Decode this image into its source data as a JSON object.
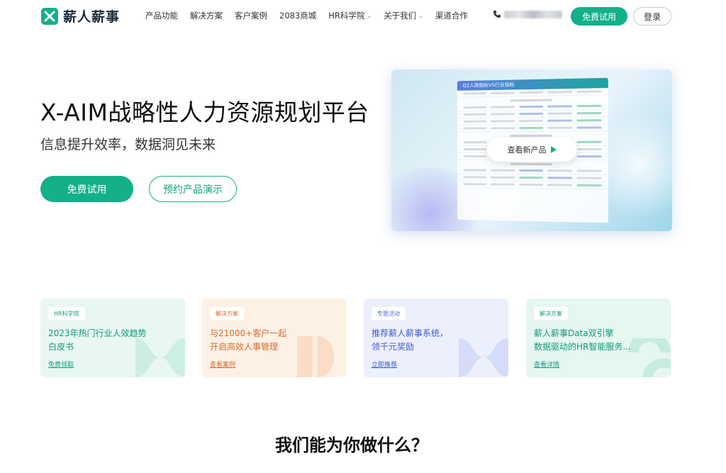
{
  "header": {
    "logo_text": "薪人薪事",
    "nav": [
      {
        "label": "产品功能",
        "dropdown": false
      },
      {
        "label": "解决方案",
        "dropdown": false
      },
      {
        "label": "客户案例",
        "dropdown": false
      },
      {
        "label": "2083商城",
        "dropdown": false
      },
      {
        "label": "HR科学院",
        "dropdown": true
      },
      {
        "label": "关于我们",
        "dropdown": true
      },
      {
        "label": "渠道合作",
        "dropdown": false
      }
    ],
    "trial_label": "免费试用",
    "login_label": "登录"
  },
  "hero": {
    "title": "X-AIM战略性人力资源规划平台",
    "subtitle": "信息提升效率，数据洞见未来",
    "trial_label": "免费试用",
    "demo_label": "预约产品演示"
  },
  "preview": {
    "table_title": "Q2人效指标VS行业指标",
    "cta_label": "查看新产品"
  },
  "cards": [
    {
      "tag": "HR科学院",
      "line1": "2023年热门行业人效趋势",
      "line2": "白皮书",
      "link": "免费领取"
    },
    {
      "tag": "解决方案",
      "line1": "与21000+客户一起",
      "line2": "开启高效人事管理",
      "link": "查看案例"
    },
    {
      "tag": "专题活动",
      "line1": "推荐薪人薪事系统，",
      "line2": "领千元奖励",
      "link": "立即推荐"
    },
    {
      "tag": "解决方案",
      "line1": "薪人薪事Data双引擎",
      "line2": "数据驱动的HR智能服务...",
      "link": "查看详情"
    }
  ],
  "section": {
    "title": "我们能为你做什么？"
  },
  "colors": {
    "brand": "#13b08a",
    "card1_bg": "#e8f7f2",
    "card2_bg": "#fdf1e6",
    "card3_bg": "#ecf0fd",
    "card4_bg": "#e6f6f1"
  },
  "icons": {
    "logo": "logo-icon",
    "phone": "phone-icon",
    "caret": "chevron-down-icon",
    "play": "play-icon"
  }
}
